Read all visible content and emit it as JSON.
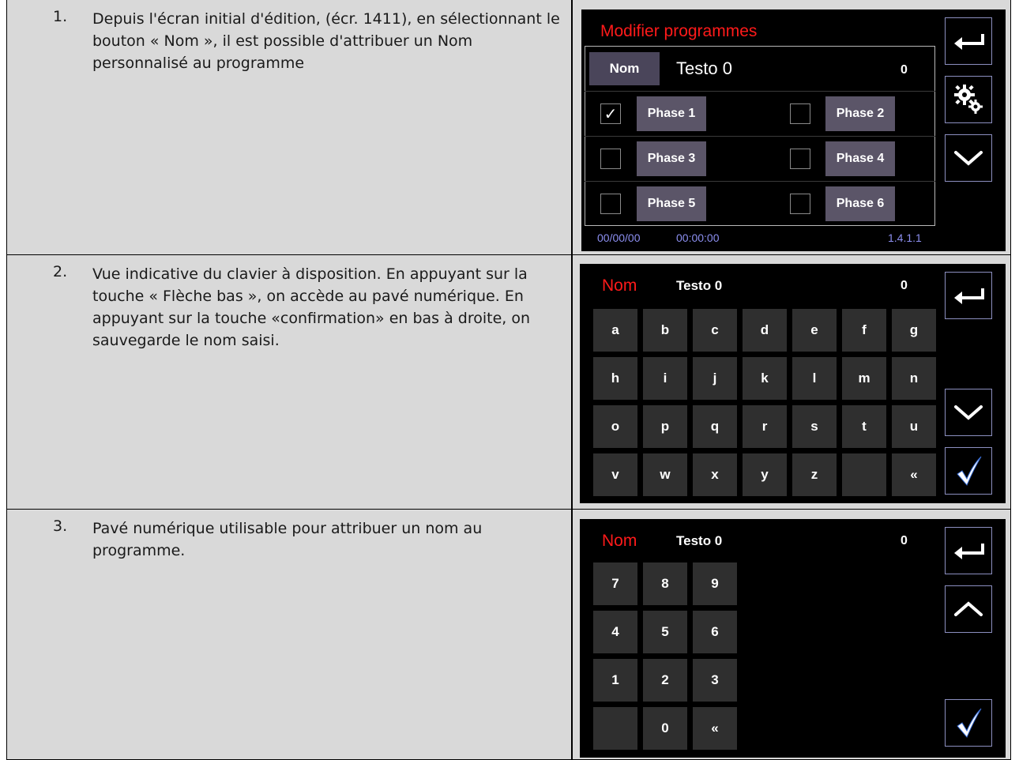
{
  "rows": [
    {
      "num": "1.",
      "text": "Depuis l'écran initial d'édition, (écr. 1411), en sélectionnant le bouton « Nom », il est possible d'attribuer un Nom personnalisé au programme"
    },
    {
      "num": "2.",
      "text": "Vue indicative du clavier à disposition. En appuyant sur la touche « Flèche bas », on accède au pavé numérique. En appuyant sur la touche «confirmation» en bas à droite, on sauvegarde le nom saisi."
    },
    {
      "num": "3.",
      "text": "Pavé numérique utilisable pour attribuer un nom au programme."
    }
  ],
  "screen1": {
    "title": "Modifier programmes",
    "nom_button": "Nom",
    "program_name": "Testo 0",
    "counter": "0",
    "phases": [
      {
        "label": "Phase 1",
        "checked": true,
        "check_mark": "✓"
      },
      {
        "label": "Phase 2",
        "checked": false,
        "check_mark": ""
      },
      {
        "label": "Phase 3",
        "checked": false,
        "check_mark": ""
      },
      {
        "label": "Phase 4",
        "checked": false,
        "check_mark": ""
      },
      {
        "label": "Phase 5",
        "checked": false,
        "check_mark": ""
      },
      {
        "label": "Phase 6",
        "checked": false,
        "check_mark": ""
      }
    ],
    "date": "00/00/00",
    "time": "00:00:00",
    "version": "1.4.1.1"
  },
  "screen2": {
    "title": "Nom",
    "program_name": "Testo 0",
    "counter": "0",
    "keys": [
      [
        "a",
        "b",
        "c",
        "d",
        "e",
        "f",
        "g"
      ],
      [
        "h",
        "i",
        "j",
        "k",
        "l",
        "m",
        "n"
      ],
      [
        "o",
        "p",
        "q",
        "r",
        "s",
        "t",
        "u"
      ],
      [
        "v",
        "w",
        "x",
        "y",
        "z",
        "",
        "«"
      ]
    ]
  },
  "screen3": {
    "title": "Nom",
    "program_name": "Testo 0",
    "counter": "0",
    "keys": [
      [
        "7",
        "8",
        "9"
      ],
      [
        "4",
        "5",
        "6"
      ],
      [
        "1",
        "2",
        "3"
      ],
      [
        "",
        "0",
        "«"
      ]
    ]
  },
  "colors": {
    "title_red": "#ff1a1a",
    "row_bg": "#d9d9d9",
    "button_border": "#8c8fc0",
    "status_text": "#8c8ff0"
  },
  "icons": [
    "back-arrow-icon",
    "gear-icon",
    "chevron-down-icon",
    "chevron-up-icon",
    "checkmark-icon"
  ]
}
